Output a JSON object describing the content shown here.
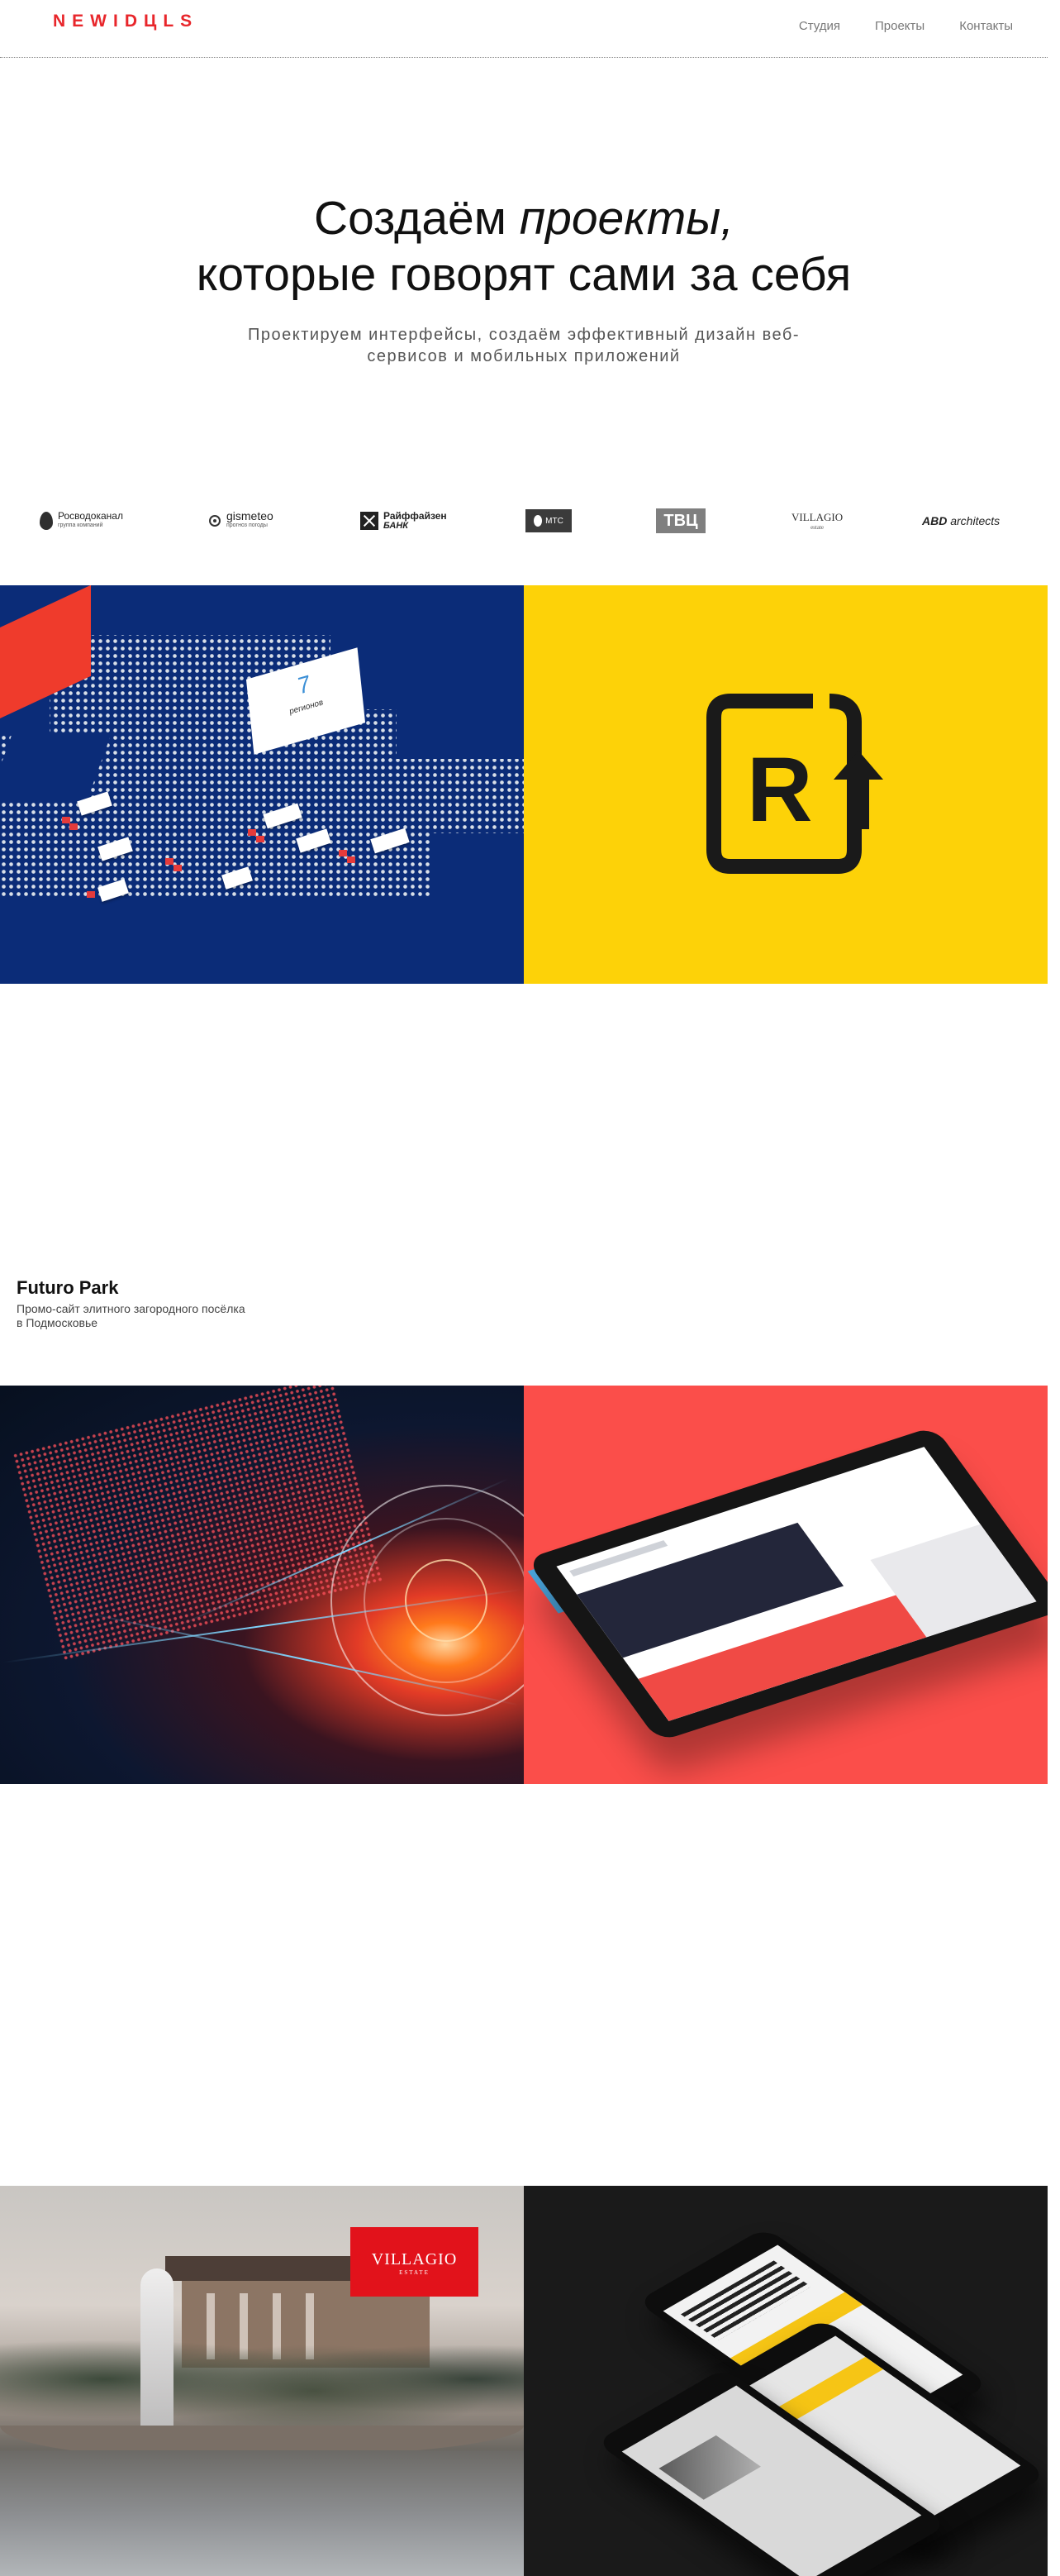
{
  "header": {
    "logo": "NEWIDЦLS",
    "nav": [
      "Студия",
      "Проекты",
      "Контакты"
    ]
  },
  "hero": {
    "title_line1_plain": "Создаём ",
    "title_line1_em": "проекты,",
    "title_line2": "которые говорят сами за себя",
    "subtitle": "Проектируем интерфейсы, создаём эффективный дизайн веб-сервисов и мобильных приложений"
  },
  "clients": [
    {
      "name": "Росводоканал",
      "sub": "группа компаний",
      "icon": "drop-icon"
    },
    {
      "name": "gismeteo",
      "sub": "прогноз погоды",
      "icon": "gismeteo-icon"
    },
    {
      "name": "Райффайзен",
      "sub": "БАНК",
      "icon": "raiffeisen-icon"
    },
    {
      "name": "МТС",
      "icon": "mts-egg-icon"
    },
    {
      "name": "ТВЦ",
      "icon": "tvc-icon"
    },
    {
      "name": "VILLAGIO",
      "sub": "estate",
      "icon": "villagio-icon"
    },
    {
      "name": "ABD",
      "name2": " architects",
      "icon": "abd-icon"
    }
  ],
  "tiles": {
    "map_card_number": "7",
    "map_card_label": "регионов",
    "villagio_badge": "VILLAGIO",
    "villagio_badge_sub": "ESTATE",
    "r_letter": "R"
  },
  "project": {
    "title": "Futuro Park",
    "description": "Промо-сайт элитного загородного посёлка в Подмосковье"
  },
  "colors": {
    "brand_red": "#e8262b",
    "map_blue": "#0b2c78",
    "yellow": "#fdd208",
    "coral": "#fb4e4a",
    "villagio_red": "#e2121b",
    "app_bg": "#1a1a1a"
  }
}
